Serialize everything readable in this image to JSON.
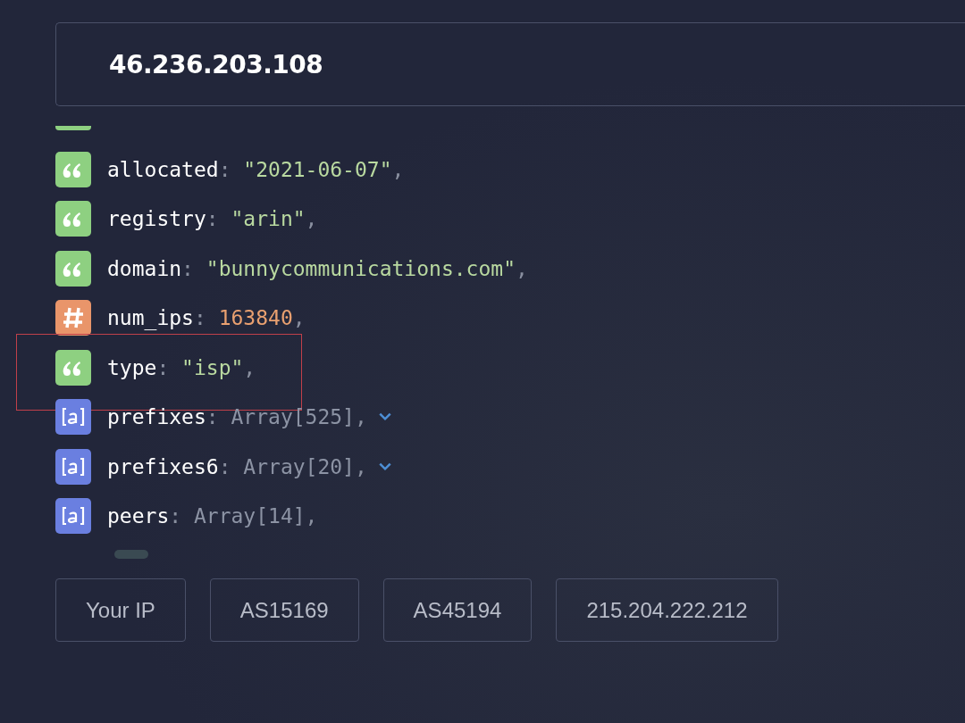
{
  "search": {
    "value": "46.236.203.108"
  },
  "fields": [
    {
      "key": "allocated",
      "separator": ":",
      "trailer": ",",
      "kind": "string",
      "value": "\"2021-06-07\"",
      "expandable": false,
      "highlighted": false
    },
    {
      "key": "registry",
      "separator": ":",
      "trailer": ",",
      "kind": "string",
      "value": "\"arin\"",
      "expandable": false,
      "highlighted": false
    },
    {
      "key": "domain",
      "separator": ":",
      "trailer": ",",
      "kind": "string",
      "value": "\"bunnycommunications.com\"",
      "expandable": false,
      "highlighted": false
    },
    {
      "key": "num_ips",
      "separator": ":",
      "trailer": ",",
      "kind": "number",
      "value": "163840",
      "expandable": false,
      "highlighted": false
    },
    {
      "key": "type",
      "separator": ":",
      "trailer": ",",
      "kind": "string",
      "value": "\"isp\"",
      "expandable": false,
      "highlighted": true
    },
    {
      "key": "prefixes",
      "separator": ":",
      "trailer": ",",
      "kind": "array",
      "value": "Array[525]",
      "expandable": true,
      "highlighted": false
    },
    {
      "key": "prefixes6",
      "separator": ":",
      "trailer": ",",
      "kind": "array",
      "value": "Array[20]",
      "expandable": true,
      "highlighted": false
    },
    {
      "key": "peers",
      "separator": ":",
      "trailer": ",",
      "kind": "array",
      "value": "Array[14]",
      "expandable": false,
      "highlighted": false
    }
  ],
  "buttons": [
    "Your IP",
    "AS15169",
    "AS45194",
    "215.204.222.212"
  ]
}
